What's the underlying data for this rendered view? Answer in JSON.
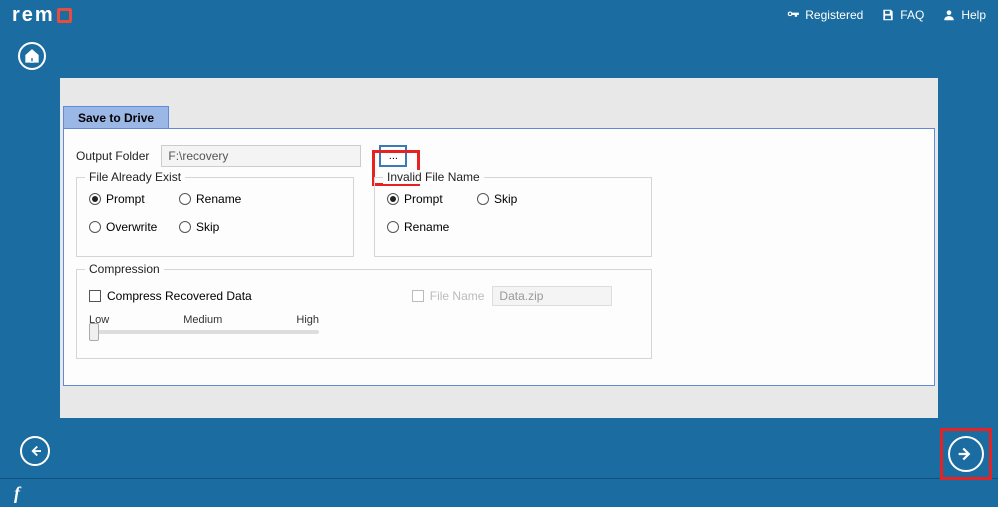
{
  "app": {
    "logo_text": "rem"
  },
  "header": {
    "registered": "Registered",
    "faq": "FAQ",
    "help": "Help"
  },
  "panel": {
    "tab_label": "Save to Drive",
    "output_folder_label": "Output Folder",
    "output_folder_value": "F:\\recovery",
    "browse_label": "..."
  },
  "file_exist": {
    "title": "File Already Exist",
    "options": {
      "prompt": "Prompt",
      "rename": "Rename",
      "overwrite": "Overwrite",
      "skip": "Skip"
    },
    "selected": "prompt"
  },
  "invalid_name": {
    "title": "Invalid File Name",
    "options": {
      "prompt": "Prompt",
      "skip": "Skip",
      "rename": "Rename"
    },
    "selected": "prompt"
  },
  "compression": {
    "title": "Compression",
    "compress_label": "Compress Recovered Data",
    "filename_label": "File Name",
    "filename_value": "Data.zip",
    "slider": {
      "low": "Low",
      "medium": "Medium",
      "high": "High"
    }
  },
  "footer": {
    "fb": "f"
  }
}
